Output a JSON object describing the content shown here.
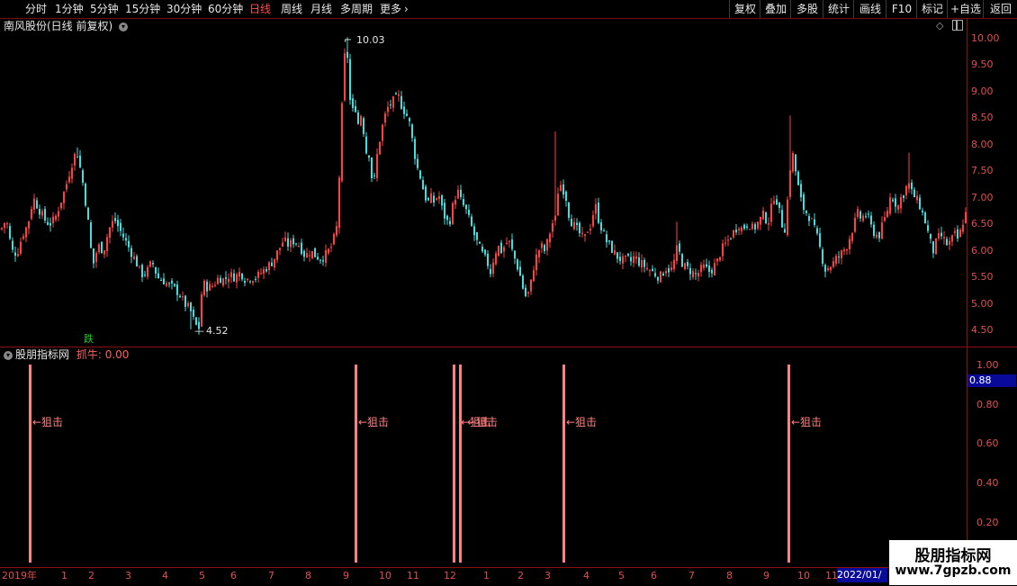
{
  "toolbar": {
    "periods": [
      {
        "label": "分时",
        "active": false
      },
      {
        "label": "1分钟",
        "active": false
      },
      {
        "label": "5分钟",
        "active": false
      },
      {
        "label": "15分钟",
        "active": false
      },
      {
        "label": "30分钟",
        "active": false
      },
      {
        "label": "60分钟",
        "active": false
      },
      {
        "label": "日线",
        "active": true
      },
      {
        "label": "周线",
        "active": false
      },
      {
        "label": "月线",
        "active": false
      },
      {
        "label": "多周期",
        "active": false
      },
      {
        "label": "更多",
        "active": false
      }
    ],
    "more_chevron": "›",
    "right_buttons": [
      "复权",
      "叠加",
      "多股",
      "统计",
      "画线",
      "F10",
      "标记",
      "+自选",
      "返回"
    ]
  },
  "price_panel": {
    "title": "南风股份(日线 前复权)",
    "toggle_icon": "chevron-down-icon",
    "high_label": "10.03",
    "low_label": "4.52",
    "signal_label": "跌",
    "axis_labels": [
      "10.00",
      "9.50",
      "9.00",
      "8.50",
      "8.00",
      "7.50",
      "7.00",
      "6.50",
      "6.00",
      "5.50",
      "5.00",
      "4.50"
    ]
  },
  "indicator_panel": {
    "title": "股朋指标网",
    "indicator_name": "抓牛",
    "indicator_value": "0.00",
    "current_value": "0.88",
    "axis_labels": [
      "1.00",
      "0.80",
      "0.60",
      "0.40",
      "0.20"
    ],
    "signal_text": "←狙击",
    "overlap_text": "←狙击"
  },
  "chart_data": {
    "type": "candlestick",
    "title": "南风股份(日线 前复权)",
    "ylim": [
      4.4,
      10.2
    ],
    "high": 10.03,
    "low": 4.52,
    "close_path": [
      [
        0,
        6.4
      ],
      [
        6,
        6.6
      ],
      [
        12,
        6.0
      ],
      [
        18,
        5.95
      ],
      [
        24,
        6.3
      ],
      [
        30,
        6.5
      ],
      [
        36,
        7.0
      ],
      [
        42,
        6.8
      ],
      [
        48,
        6.6
      ],
      [
        54,
        6.5
      ],
      [
        60,
        6.6
      ],
      [
        66,
        6.9
      ],
      [
        72,
        7.2
      ],
      [
        78,
        7.6
      ],
      [
        84,
        7.9
      ],
      [
        90,
        7.4
      ],
      [
        96,
        6.7
      ],
      [
        102,
        5.7
      ],
      [
        108,
        6.1
      ],
      [
        114,
        6.0
      ],
      [
        120,
        6.4
      ],
      [
        126,
        6.6
      ],
      [
        132,
        6.4
      ],
      [
        138,
        6.2
      ],
      [
        144,
        6.0
      ],
      [
        150,
        5.8
      ],
      [
        156,
        5.55
      ],
      [
        162,
        5.6
      ],
      [
        168,
        5.8
      ],
      [
        174,
        5.5
      ],
      [
        180,
        5.45
      ],
      [
        186,
        5.35
      ],
      [
        192,
        5.3
      ],
      [
        198,
        5.2
      ],
      [
        204,
        5.0
      ],
      [
        210,
        4.9
      ],
      [
        216,
        4.6
      ],
      [
        220,
        4.55
      ],
      [
        224,
        5.4
      ],
      [
        230,
        5.3
      ],
      [
        236,
        5.35
      ],
      [
        242,
        5.5
      ],
      [
        248,
        5.45
      ],
      [
        254,
        5.55
      ],
      [
        260,
        5.5
      ],
      [
        266,
        5.6
      ],
      [
        272,
        5.45
      ],
      [
        278,
        5.5
      ],
      [
        284,
        5.5
      ],
      [
        290,
        5.6
      ],
      [
        296,
        5.7
      ],
      [
        302,
        5.8
      ],
      [
        308,
        6.0
      ],
      [
        314,
        6.2
      ],
      [
        320,
        6.1
      ],
      [
        326,
        6.2
      ],
      [
        332,
        6.1
      ],
      [
        338,
        5.9
      ],
      [
        344,
        6.0
      ],
      [
        350,
        5.9
      ],
      [
        356,
        5.85
      ],
      [
        362,
        5.95
      ],
      [
        368,
        6.1
      ],
      [
        374,
        6.5
      ],
      [
        378,
        8.3
      ],
      [
        381,
        9.5
      ],
      [
        384,
        10.0
      ],
      [
        387,
        9.0
      ],
      [
        390,
        8.5
      ],
      [
        393,
        8.9
      ],
      [
        396,
        8.3
      ],
      [
        399,
        8.6
      ],
      [
        402,
        8.5
      ],
      [
        405,
        7.8
      ],
      [
        408,
        8.0
      ],
      [
        411,
        7.5
      ],
      [
        414,
        7.2
      ],
      [
        418,
        7.8
      ],
      [
        422,
        8.2
      ],
      [
        426,
        8.5
      ],
      [
        430,
        8.7
      ],
      [
        434,
        8.8
      ],
      [
        438,
        8.85
      ],
      [
        442,
        8.9
      ],
      [
        446,
        8.7
      ],
      [
        450,
        8.6
      ],
      [
        454,
        8.4
      ],
      [
        458,
        8.0
      ],
      [
        462,
        7.6
      ],
      [
        466,
        7.4
      ],
      [
        470,
        7.1
      ],
      [
        474,
        6.9
      ],
      [
        478,
        7.0
      ],
      [
        482,
        6.9
      ],
      [
        486,
        7.1
      ],
      [
        490,
        6.8
      ],
      [
        494,
        6.6
      ],
      [
        498,
        6.5
      ],
      [
        504,
        7.0
      ],
      [
        508,
        7.1
      ],
      [
        512,
        6.9
      ],
      [
        516,
        6.8
      ],
      [
        520,
        6.6
      ],
      [
        524,
        6.4
      ],
      [
        528,
        6.2
      ],
      [
        532,
        6.05
      ],
      [
        536,
        5.9
      ],
      [
        540,
        5.8
      ],
      [
        544,
        5.6
      ],
      [
        548,
        5.9
      ],
      [
        552,
        6.1
      ],
      [
        556,
        6.0
      ],
      [
        560,
        6.1
      ],
      [
        564,
        6.2
      ],
      [
        568,
        6.0
      ],
      [
        572,
        5.8
      ],
      [
        576,
        5.6
      ],
      [
        580,
        5.3
      ],
      [
        584,
        5.1
      ],
      [
        588,
        5.3
      ],
      [
        592,
        5.7
      ],
      [
        596,
        5.95
      ],
      [
        600,
        6.1
      ],
      [
        604,
        6.0
      ],
      [
        608,
        6.2
      ],
      [
        612,
        6.5
      ],
      [
        616,
        6.6
      ],
      [
        620,
        7.3
      ],
      [
        624,
        7.2
      ],
      [
        628,
        7.0
      ],
      [
        632,
        6.6
      ],
      [
        636,
        6.5
      ],
      [
        640,
        6.4
      ],
      [
        644,
        6.3
      ],
      [
        648,
        6.2
      ],
      [
        652,
        6.4
      ],
      [
        656,
        6.5
      ],
      [
        660,
        6.9
      ],
      [
        664,
        6.6
      ],
      [
        668,
        6.4
      ],
      [
        672,
        6.2
      ],
      [
        676,
        6.1
      ],
      [
        680,
        6.0
      ],
      [
        684,
        5.9
      ],
      [
        688,
        5.85
      ],
      [
        692,
        5.8
      ],
      [
        696,
        5.85
      ],
      [
        700,
        5.8
      ],
      [
        704,
        5.9
      ],
      [
        708,
        5.8
      ],
      [
        712,
        5.75
      ],
      [
        716,
        5.7
      ],
      [
        720,
        5.65
      ],
      [
        724,
        5.6
      ],
      [
        728,
        5.55
      ],
      [
        732,
        5.5
      ],
      [
        736,
        5.6
      ],
      [
        740,
        5.7
      ],
      [
        744,
        5.6
      ],
      [
        748,
        5.8
      ],
      [
        752,
        6.1
      ],
      [
        756,
        5.8
      ],
      [
        760,
        5.7
      ],
      [
        764,
        5.65
      ],
      [
        768,
        5.6
      ],
      [
        772,
        5.55
      ],
      [
        776,
        5.6
      ],
      [
        780,
        5.7
      ],
      [
        784,
        5.65
      ],
      [
        788,
        5.6
      ],
      [
        792,
        5.7
      ],
      [
        796,
        5.8
      ],
      [
        800,
        6.0
      ],
      [
        804,
        6.1
      ],
      [
        808,
        6.2
      ],
      [
        812,
        6.3
      ],
      [
        816,
        6.4
      ],
      [
        820,
        6.5
      ],
      [
        824,
        6.4
      ],
      [
        828,
        6.5
      ],
      [
        832,
        6.5
      ],
      [
        836,
        6.4
      ],
      [
        840,
        6.5
      ],
      [
        844,
        6.6
      ],
      [
        848,
        6.7
      ],
      [
        852,
        6.5
      ],
      [
        856,
        6.8
      ],
      [
        860,
        7.1
      ],
      [
        864,
        6.8
      ],
      [
        868,
        6.5
      ],
      [
        872,
        6.4
      ],
      [
        876,
        7.5
      ],
      [
        880,
        7.8
      ],
      [
        884,
        7.4
      ],
      [
        888,
        7.0
      ],
      [
        892,
        6.8
      ],
      [
        896,
        6.7
      ],
      [
        900,
        6.6
      ],
      [
        904,
        6.4
      ],
      [
        908,
        6.2
      ],
      [
        912,
        5.9
      ],
      [
        916,
        5.65
      ],
      [
        920,
        5.7
      ],
      [
        924,
        5.75
      ],
      [
        928,
        5.85
      ],
      [
        932,
        5.9
      ],
      [
        936,
        6.0
      ],
      [
        940,
        6.1
      ],
      [
        944,
        6.3
      ],
      [
        948,
        6.5
      ],
      [
        952,
        6.7
      ],
      [
        956,
        6.6
      ],
      [
        960,
        6.7
      ],
      [
        964,
        6.6
      ],
      [
        968,
        6.4
      ],
      [
        972,
        6.3
      ],
      [
        976,
        6.3
      ],
      [
        980,
        6.5
      ],
      [
        984,
        6.7
      ],
      [
        988,
        7.0
      ],
      [
        992,
        7.0
      ],
      [
        996,
        6.8
      ],
      [
        1000,
        7.0
      ],
      [
        1004,
        7.1
      ],
      [
        1008,
        7.3
      ],
      [
        1012,
        7.1
      ],
      [
        1016,
        7.0
      ],
      [
        1020,
        6.9
      ],
      [
        1024,
        6.7
      ],
      [
        1028,
        6.5
      ],
      [
        1032,
        6.2
      ],
      [
        1036,
        6.0
      ],
      [
        1040,
        6.2
      ],
      [
        1044,
        6.3
      ],
      [
        1048,
        6.2
      ],
      [
        1052,
        6.1
      ],
      [
        1056,
        6.2
      ],
      [
        1060,
        6.3
      ],
      [
        1064,
        6.2
      ],
      [
        1068,
        6.5
      ],
      [
        1072,
        6.7
      ]
    ],
    "spikes": [
      {
        "i": 84,
        "h": 7.95
      },
      {
        "i": 384,
        "h": 10.03
      },
      {
        "i": 210,
        "l": 4.52
      },
      {
        "i": 616,
        "h": 8.25
      },
      {
        "i": 876,
        "h": 8.55
      },
      {
        "i": 1008,
        "h": 7.85
      },
      {
        "i": 752,
        "h": 6.55
      }
    ],
    "indicator": {
      "name": "抓牛",
      "ylim": [
        0,
        1.0
      ],
      "signals": [
        {
          "bar": 32,
          "value": 1.0
        },
        {
          "bar": 394,
          "value": 1.0
        },
        {
          "bar": 503,
          "value": 1.0
        },
        {
          "bar": 510,
          "value": 1.0
        },
        {
          "bar": 625,
          "value": 1.0
        },
        {
          "bar": 875,
          "value": 1.0
        }
      ]
    },
    "date_labels": [
      "2019年",
      "1",
      "2",
      "3",
      "4",
      "5",
      "6",
      "7",
      "8",
      "9",
      "10",
      "11",
      "12",
      "1",
      "2",
      "3",
      "4",
      "5",
      "6",
      "7",
      "8",
      "9",
      "10",
      "11"
    ],
    "current_date": "2022/01/"
  },
  "watermark": {
    "title": "股朋指标网",
    "url": "www.7gpzb.com"
  },
  "colors": {
    "up": "#ff4040",
    "down": "#40e0e0",
    "signal": "#ff8080",
    "axis": "#e05050",
    "grid": "#8a1010"
  }
}
